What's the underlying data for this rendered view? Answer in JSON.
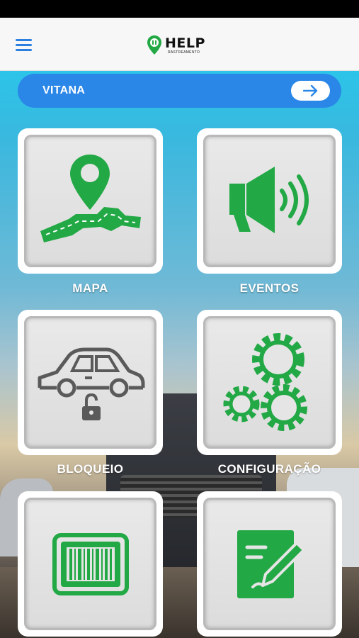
{
  "header": {
    "logo_text": "HELP",
    "logo_subtext": "RASTREAMENTO"
  },
  "vehicle_bar": {
    "name": "VITANA"
  },
  "tiles": [
    {
      "label": "MAPA",
      "icon": "map-pin-road-icon"
    },
    {
      "label": "EVENTOS",
      "icon": "megaphone-icon"
    },
    {
      "label": "BLOQUEIO",
      "icon": "car-lock-icon"
    },
    {
      "label": "CONFIGURAÇÃO",
      "icon": "gears-icon"
    },
    {
      "label": "",
      "icon": "barcode-icon"
    },
    {
      "label": "",
      "icon": "note-edit-icon"
    }
  ],
  "colors": {
    "accent_blue": "#2a87e8",
    "icon_green": "#22a845",
    "icon_gray": "#5a5a5a"
  }
}
